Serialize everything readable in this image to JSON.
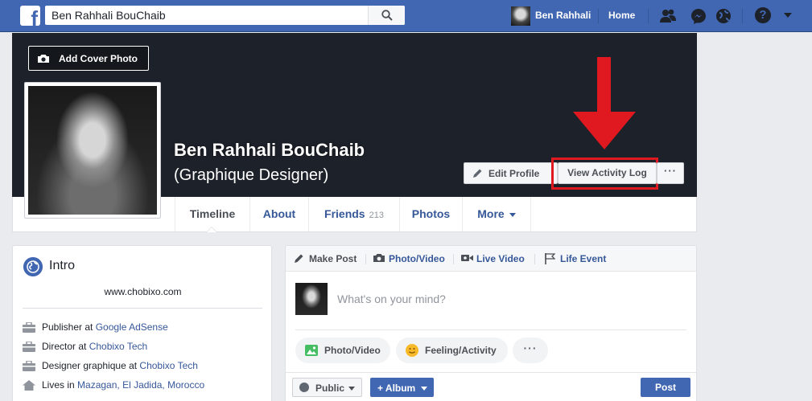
{
  "topbar": {
    "logo": "f",
    "search_value": "Ben Rahhali BouChaib",
    "user_name": "Ben Rahhali",
    "home_label": "Home",
    "help_label": "?"
  },
  "cover": {
    "add_cover_label": "Add Cover Photo",
    "profile_name": "Ben Rahhali BouChaib",
    "profile_subtitle": "(Graphique Designer)",
    "edit_profile_label": "Edit Profile",
    "activity_log_label": "View Activity Log",
    "more_label": "···",
    "highlight_color": "#e0181f"
  },
  "nav": {
    "tabs": [
      {
        "label": "Timeline"
      },
      {
        "label": "About"
      },
      {
        "label": "Friends",
        "count": "213"
      },
      {
        "label": "Photos"
      },
      {
        "label": "More"
      }
    ]
  },
  "intro": {
    "title": "Intro",
    "website": "www.chobixo.com",
    "rows": [
      {
        "prefix": "Publisher at ",
        "link": "Google AdSense",
        "icon": "briefcase-icon"
      },
      {
        "prefix": "Director at ",
        "link": "Chobixo Tech",
        "icon": "briefcase-icon"
      },
      {
        "prefix": "Designer graphique at ",
        "link": "Chobixo Tech",
        "icon": "briefcase-icon"
      },
      {
        "prefix": "Lives in ",
        "link": "Mazagan, El Jadida, Morocco",
        "icon": "home-icon"
      }
    ]
  },
  "composer": {
    "tabs": [
      {
        "label": "Make Post",
        "icon": "pencil-icon"
      },
      {
        "label": "Photo/Video",
        "icon": "camera-icon"
      },
      {
        "label": "Live Video",
        "icon": "video-icon"
      },
      {
        "label": "Life Event",
        "icon": "flag-icon"
      }
    ],
    "placeholder": "What's on your mind?",
    "photo_video_label": "Photo/Video",
    "feeling_label": "Feeling/Activity",
    "dots_label": "···",
    "public_label": "Public",
    "album_label": "+ Album",
    "post_label": "Post"
  },
  "colors": {
    "brand": "#4267b2",
    "link": "#365899",
    "background": "#e9ebee"
  }
}
